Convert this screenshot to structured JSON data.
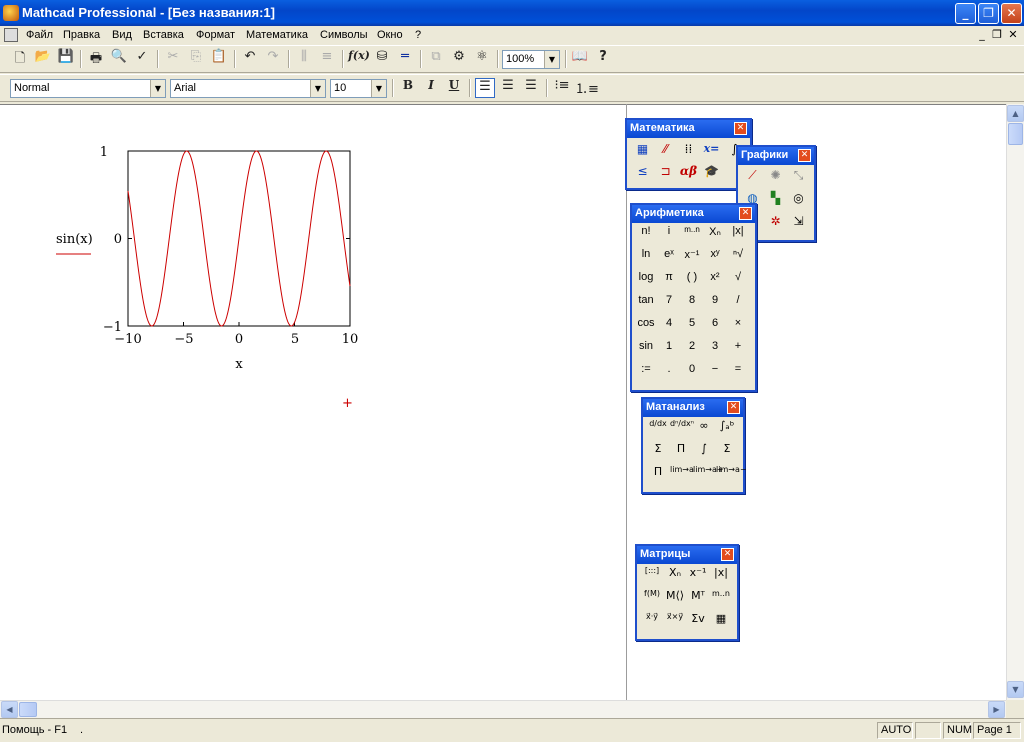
{
  "window": {
    "title": "Mathcad Professional - [Без названия:1]"
  },
  "menu": [
    "Файл",
    "Правка",
    "Вид",
    "Вставка",
    "Формат",
    "Математика",
    "Символы",
    "Окно",
    "?"
  ],
  "formatting": {
    "style": "Normal",
    "font": "Arial",
    "size": "10",
    "bold": "B",
    "italic": "I",
    "underline": "U"
  },
  "toolbar": {
    "zoom": "100%",
    "fx": "f(x)"
  },
  "plot": {
    "ylabel": "sin(x)",
    "xlabel": "x",
    "trace_color": "#cc0000"
  },
  "chart_data": {
    "type": "line",
    "series": [
      {
        "name": "sin(x)",
        "function": "sin(x)"
      }
    ],
    "x_range": [
      -10,
      10
    ],
    "ylim": [
      -1,
      1
    ],
    "x_ticks": [
      "−10",
      "−5",
      "0",
      "5",
      "10"
    ],
    "y_ticks": [
      "1",
      "0",
      "−1"
    ],
    "xlabel": "x",
    "ylabel": "sin(x)",
    "grid": false
  },
  "palettes": {
    "math": {
      "title": "Математика"
    },
    "graphs": {
      "title": "Графики"
    },
    "arithmetic": {
      "title": "Арифметика",
      "rows": [
        [
          "n!",
          "i",
          "m..n",
          "Xₙ",
          "|x|"
        ],
        [
          "ln",
          "eˣ",
          "x⁻¹",
          "xʸ",
          "ⁿ√"
        ],
        [
          "log",
          "π",
          "( )",
          "x²",
          "√"
        ],
        [
          "tan",
          "7",
          "8",
          "9",
          "/"
        ],
        [
          "cos",
          "4",
          "5",
          "6",
          "×"
        ],
        [
          "sin",
          "1",
          "2",
          "3",
          "+"
        ],
        [
          ":=",
          ".",
          "0",
          "−",
          "="
        ]
      ]
    },
    "calculus": {
      "title": "Матанализ",
      "rows": [
        [
          "d/dx",
          "dⁿ/dxⁿ",
          "∞",
          "∫ₐᵇ"
        ],
        [
          "Σ",
          "Π",
          "∫",
          "Σ"
        ],
        [
          "Π",
          "lim→a",
          "lim→a+",
          "lim→a−"
        ]
      ]
    },
    "matrix": {
      "title": "Матрицы",
      "rows": [
        [
          "[:::]",
          "Xₙ",
          "x⁻¹",
          "|x|"
        ],
        [
          "f(M)",
          "M⟨⟩",
          "Mᵀ",
          "m..n"
        ],
        [
          "x⃗·y⃗",
          "x⃗×y⃗",
          "Σv",
          "▦"
        ]
      ]
    }
  },
  "status": {
    "help": "Помощь - F1",
    "dot": ".",
    "auto": "AUTO",
    "num": "NUM",
    "page": "Page 1"
  }
}
